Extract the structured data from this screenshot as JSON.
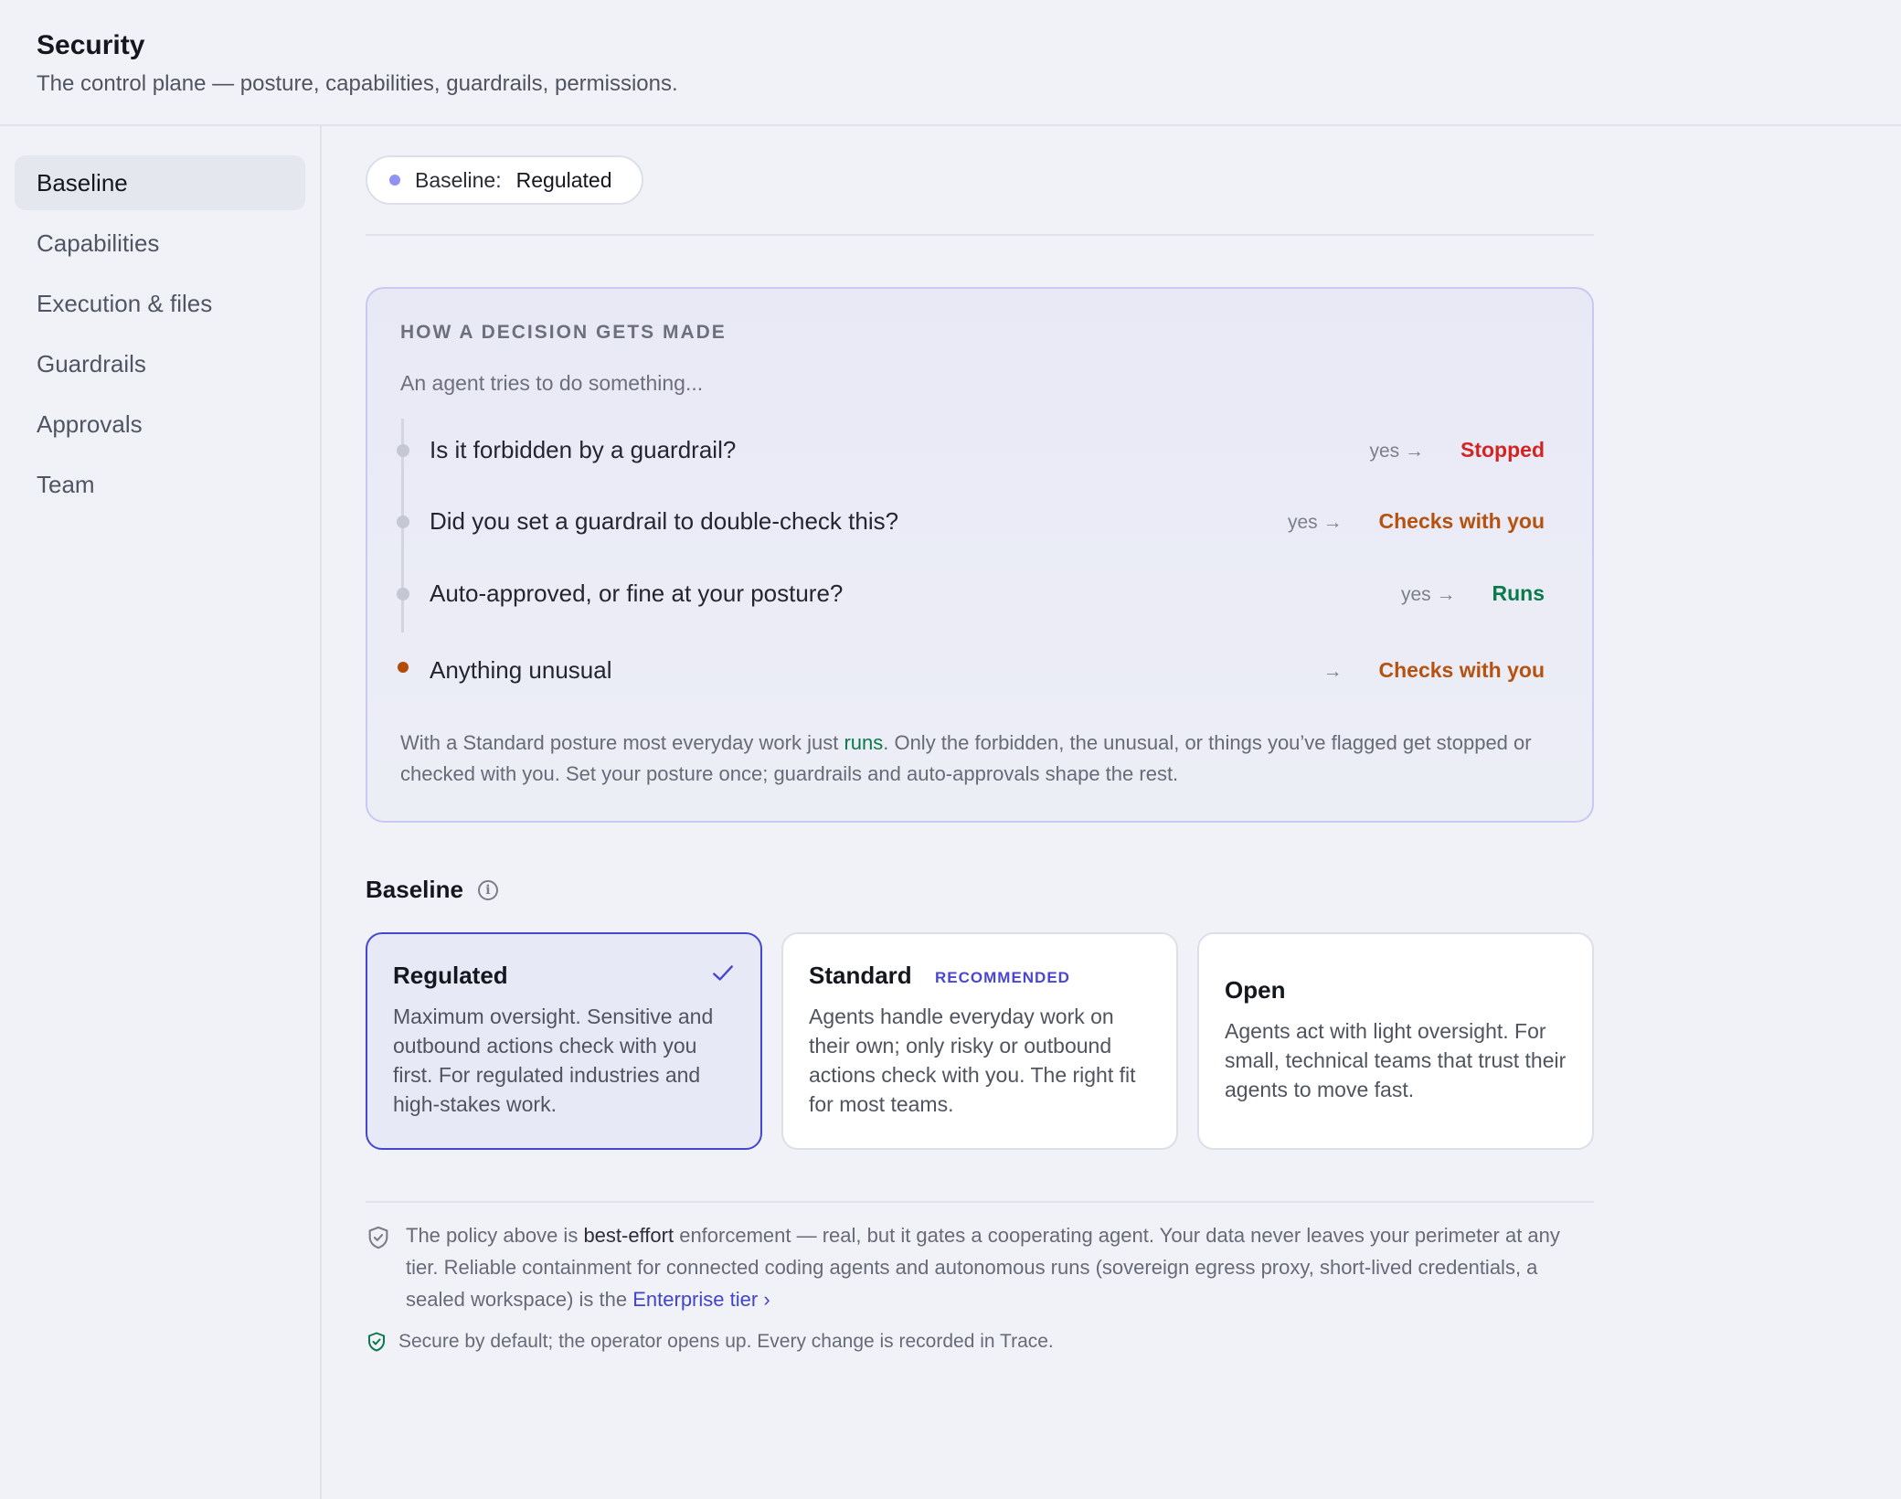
{
  "header": {
    "title": "Security",
    "subtitle": "The control plane — posture, capabilities, guardrails, permissions."
  },
  "sidebar": {
    "items": [
      {
        "label": "Baseline",
        "active": true
      },
      {
        "label": "Capabilities"
      },
      {
        "label": "Execution & files"
      },
      {
        "label": "Guardrails"
      },
      {
        "label": "Approvals"
      },
      {
        "label": "Team"
      }
    ]
  },
  "baseline_pill": {
    "label": "Baseline:",
    "value": "Regulated"
  },
  "decision": {
    "eyebrow": "HOW A DECISION GETS MADE",
    "lead": "An agent tries to do something...",
    "steps": [
      {
        "question": "Is it forbidden by a guardrail?",
        "yes": "yes →",
        "result": "Stopped"
      },
      {
        "question": "Did you set a guardrail to double-check this?",
        "yes": "yes →",
        "result": "Checks with you"
      },
      {
        "question": "Auto-approved, or fine at your posture?",
        "yes": "yes →",
        "result": "Runs"
      },
      {
        "question": "Anything unusual",
        "yes": "→",
        "result": "Checks with you"
      }
    ],
    "footnote_pre": "With a Standard posture most everyday work just ",
    "footnote_highlight": "runs",
    "footnote_post": ". Only the forbidden, the unusual, or things you’ve flagged get stopped or checked with you. Set your posture once; guardrails and auto-approvals shape the rest."
  },
  "baseline_section": {
    "title": "Baseline",
    "info_icon": "info-icon",
    "tiers": [
      {
        "name": "Regulated",
        "selected": true,
        "description": "Maximum oversight. Sensitive and outbound actions check with you first. For regulated industries and high-stakes work."
      },
      {
        "name": "Standard",
        "badge": "RECOMMENDED",
        "description": "Agents handle everyday work on their own; only risky or outbound actions check with you. The right fit for most teams."
      },
      {
        "name": "Open",
        "description": "Agents act with light oversight. For small, technical teams that trust their agents to move fast."
      }
    ]
  },
  "notice": {
    "icon": "shield-icon",
    "pre": "The policy above is ",
    "strong": "best-effort",
    "mid": " enforcement — real, but it gates a cooperating agent. Your data never leaves your perimeter at any tier. Reliable containment for connected coding agents and autonomous runs (sovereign egress proxy, short-lived credentials, a sealed workspace) is the ",
    "link": "Enterprise tier",
    "link_suffix": "›"
  },
  "secure": {
    "icon": "shield-check-icon",
    "text": "Secure by default; the operator opens up. Every change is recorded in Trace."
  },
  "colors": {
    "accent": "#4446cf",
    "stopped": "#d32424",
    "checks": "#b5520f",
    "runs": "#0a7a4a"
  }
}
